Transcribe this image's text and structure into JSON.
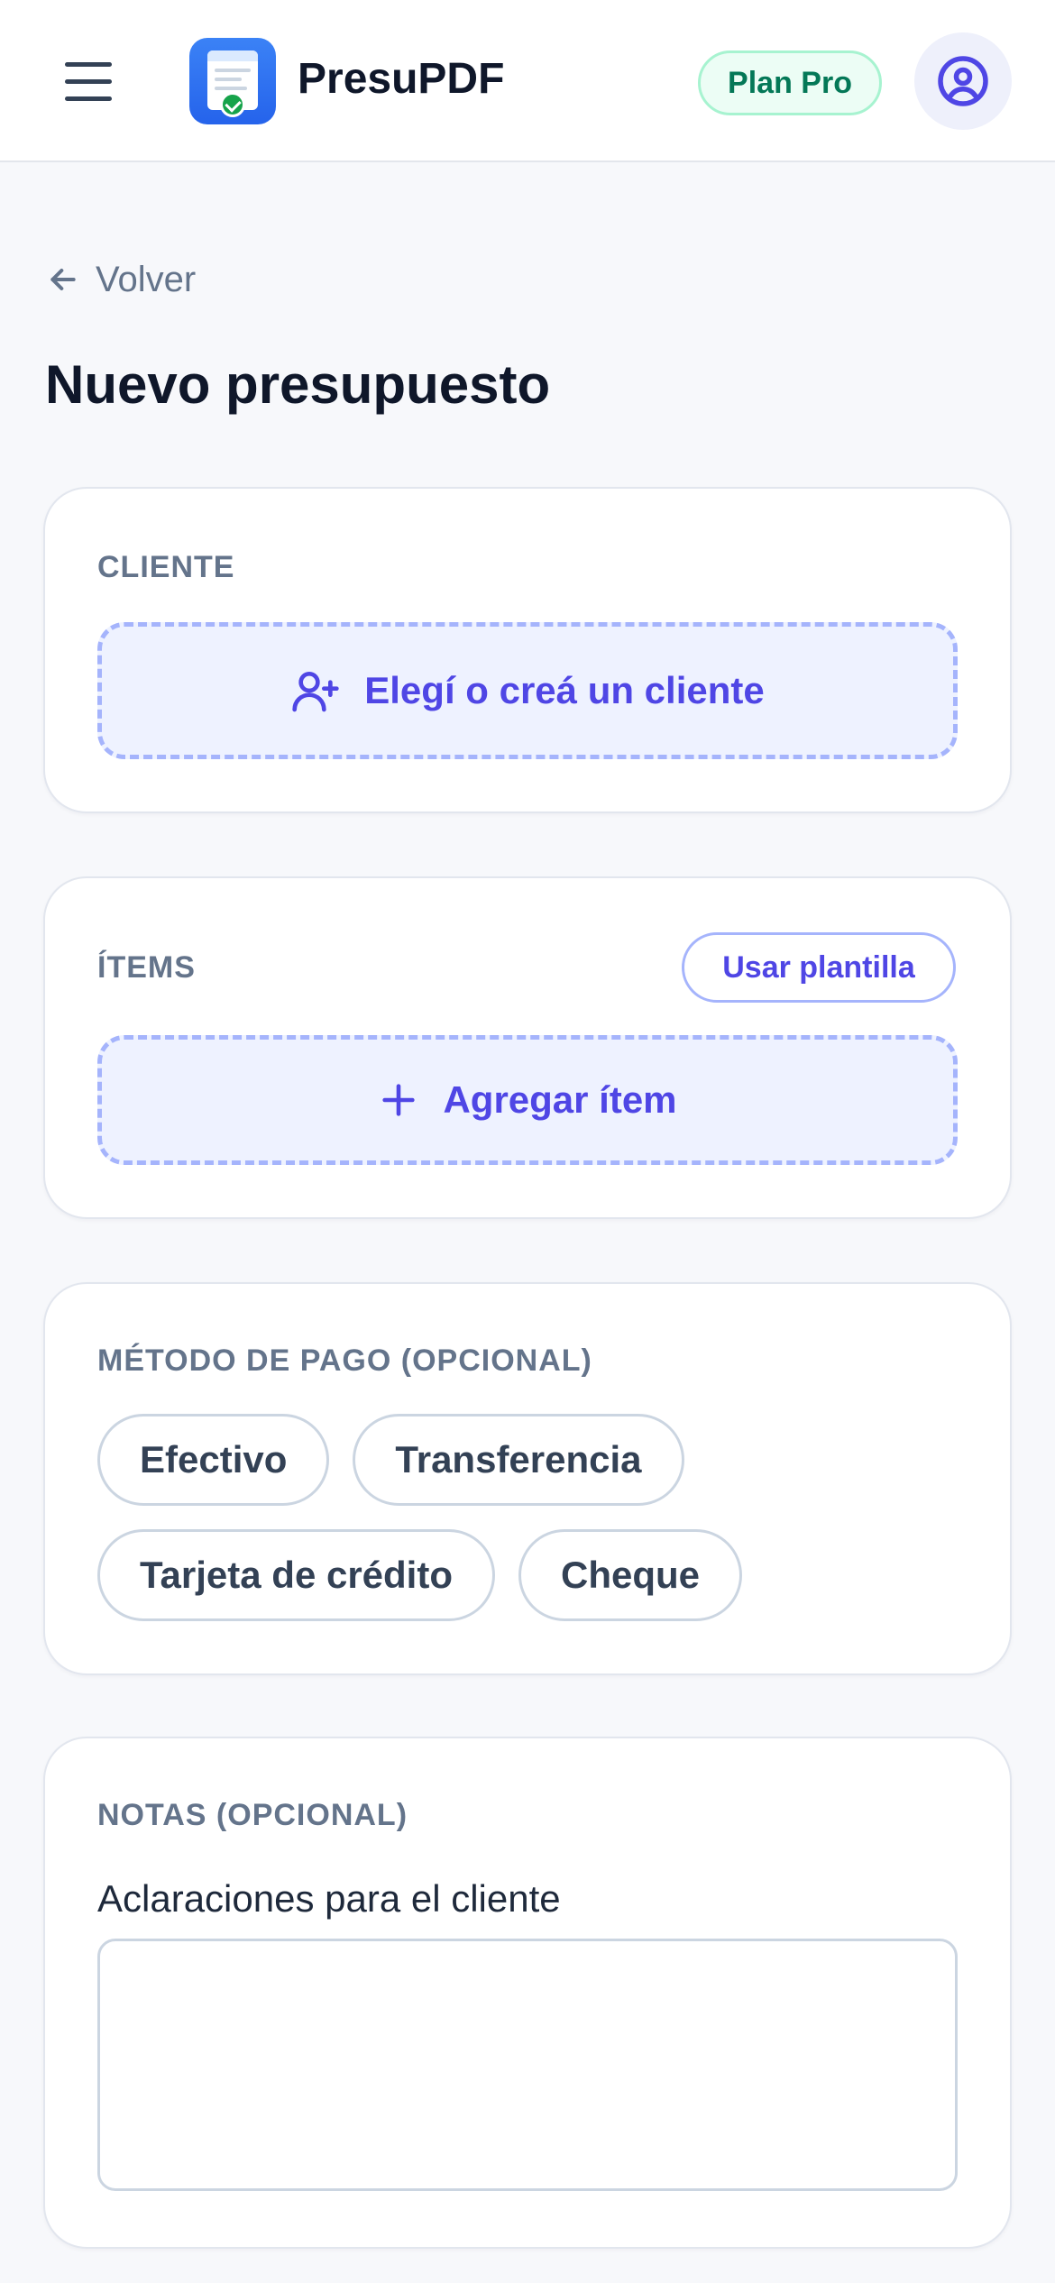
{
  "header": {
    "app_name": "PresuPDF",
    "plan_badge": "Plan Pro",
    "menu_icon": "hamburger-menu-icon",
    "account_icon": "user-circle-icon",
    "colors": {
      "accent": "#4f46e5",
      "plan": "#047857",
      "logo": "#2563eb"
    }
  },
  "nav": {
    "back_label": "Volver",
    "back_icon": "arrow-left-icon"
  },
  "page": {
    "title": "Nuevo presupuesto"
  },
  "client_section": {
    "label": "CLIENTE",
    "button_label": "Elegí o creá un cliente",
    "button_icon": "user-plus-icon"
  },
  "items_section": {
    "label": "ÍTEMS",
    "template_button": "Usar plantilla",
    "add_button": "Agregar ítem",
    "add_icon": "plus-icon"
  },
  "payment_section": {
    "label": "MÉTODO DE PAGO (OPCIONAL)",
    "options": [
      "Efectivo",
      "Transferencia",
      "Tarjeta de crédito",
      "Cheque"
    ]
  },
  "notes_section": {
    "label": "NOTAS (OPCIONAL)",
    "field_label": "Aclaraciones para el cliente",
    "value": ""
  }
}
